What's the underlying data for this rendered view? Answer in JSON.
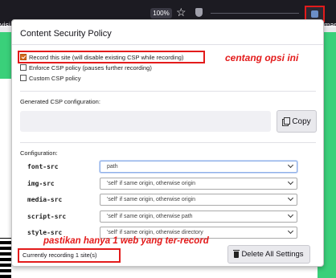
{
  "toolbar": {
    "left_tab_fragment": "visi",
    "zoom": "100%",
    "right_fragment": "marks",
    "icons": [
      "star-icon",
      "shield-icon",
      "extension-icon"
    ]
  },
  "popup": {
    "title": "Content Security Policy",
    "options": [
      {
        "label": "Record this site (will disable existing CSP while recording)",
        "checked": true
      },
      {
        "label": "Enforce CSP policy (pauses further recording)",
        "checked": false
      },
      {
        "label": "Custom CSP policy",
        "checked": false
      }
    ],
    "generated_label": "Generated CSP configuration:",
    "copy_label": "Copy",
    "config_label": "Configuration:",
    "directives": [
      {
        "name": "font-src",
        "value": "path"
      },
      {
        "name": "img-src",
        "value": "'self' if same origin, otherwise origin"
      },
      {
        "name": "media-src",
        "value": "'self' if same origin, otherwise origin"
      },
      {
        "name": "script-src",
        "value": "'self' if same origin, otherwise path"
      },
      {
        "name": "style-src",
        "value": "'self' if same origin, otherwise directory"
      }
    ],
    "status": "Currently recording 1 site(s)",
    "delete_label": "Delete All Settings"
  },
  "annotations": {
    "opsi": "centang opsi ini",
    "record": "pastikan hanya 1 web yang ter-record"
  },
  "colors": {
    "highlight": "#e31b1b",
    "page_green": "#3ad07a",
    "checkbox_checked": "#d46a1d"
  }
}
